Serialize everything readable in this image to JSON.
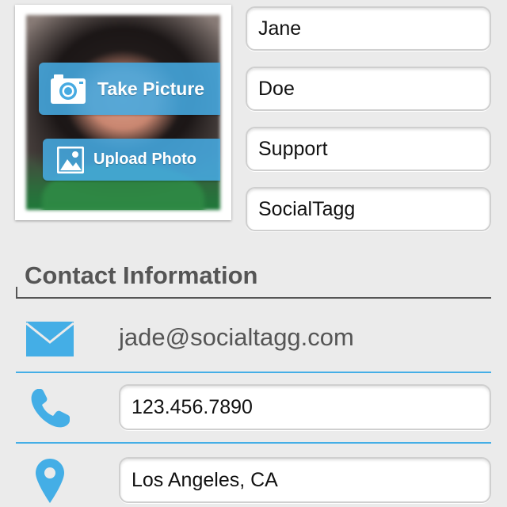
{
  "photo": {
    "take_picture_label": "Take Picture",
    "upload_photo_label": "Upload Photo",
    "take_picture_icon": "camera-icon",
    "upload_photo_icon": "image-icon"
  },
  "name_fields": {
    "first_name": "Jane",
    "last_name": "Doe",
    "department": "Support",
    "company": "SocialTagg"
  },
  "contact": {
    "section_title": "Contact Information",
    "email": "jade@socialtagg.com",
    "phone": "123.456.7890",
    "location": "Los Angeles, CA",
    "email_icon": "envelope-icon",
    "phone_icon": "phone-icon",
    "location_icon": "map-pin-icon"
  },
  "colors": {
    "accent": "#44aee6",
    "button_overlay": "#46aae1",
    "background": "#ebebeb",
    "section_text": "#555555"
  }
}
